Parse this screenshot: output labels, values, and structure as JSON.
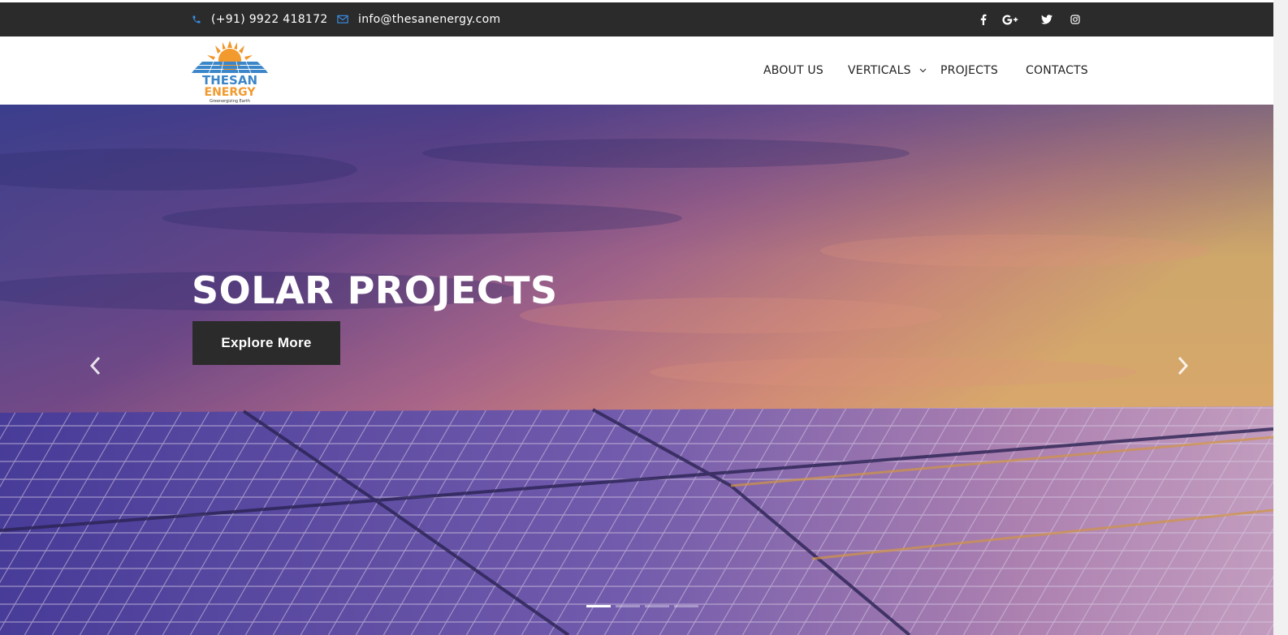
{
  "topbar": {
    "phone": "(+91) 9922 418172",
    "email": "info@thesanenergy.com",
    "socials": [
      {
        "name": "facebook-icon",
        "glyph": "f"
      },
      {
        "name": "google-plus-icon",
        "glyph": "G+"
      },
      {
        "name": "twitter-icon",
        "glyph": "t"
      },
      {
        "name": "instagram-icon",
        "glyph": "ig"
      }
    ],
    "background": "#2b2b2b",
    "icon_color": "#3a8ee6"
  },
  "logo": {
    "line1": "THESAN",
    "line2": "ENERGY",
    "tagline": "Greenergizing Earth"
  },
  "nav": {
    "items": [
      "ABOUT US",
      "VERTICALS",
      "PROJECTS",
      "CONTACTS"
    ]
  },
  "hero": {
    "title": "SOLAR PROJECTS",
    "button": "Explore More",
    "slide_count": 4,
    "active_slide": 1
  },
  "colors": {
    "dark": "#2b2b2b",
    "sky_top": "#4a4aa0",
    "sky_sunset": "#f4b05a",
    "panel": "#5a4fa8"
  }
}
